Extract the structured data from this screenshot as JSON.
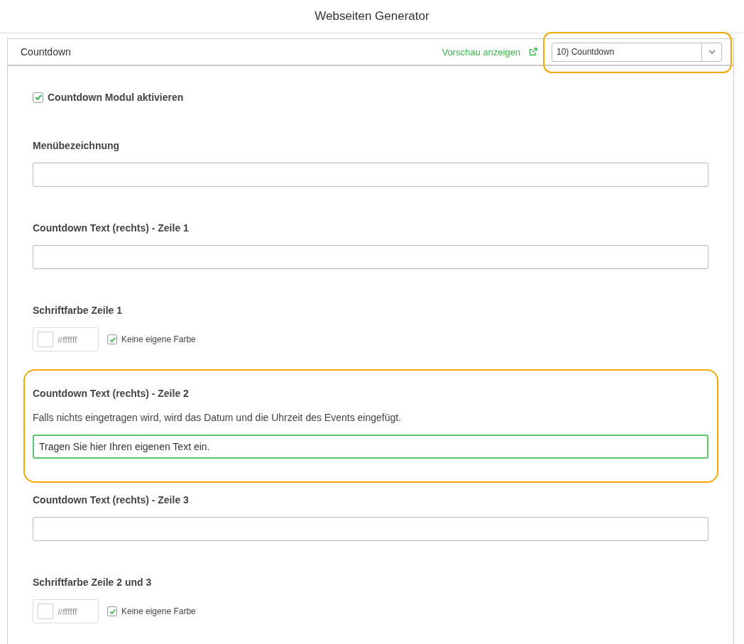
{
  "page_title": "Webseiten Generator",
  "panel": {
    "title": "Countdown",
    "preview_link": "Vorschau anzeigen",
    "module_select": {
      "value": "10) Countdown",
      "highlighted": true
    }
  },
  "fields": [
    {
      "kind": "checkbox",
      "label": "Countdown Modul aktivieren",
      "checked": true
    },
    {
      "kind": "text",
      "label": "Menübezeichnung",
      "focused": false,
      "highlighted": false
    },
    {
      "kind": "text",
      "label": "Countdown Text (rechts) - Zeile 1",
      "focused": false,
      "highlighted": false
    },
    {
      "kind": "color",
      "label": "Schriftfarbe Zeile 1",
      "color_value": "#ffffff",
      "option_label": "Keine eigene Farbe",
      "checked": true
    },
    {
      "kind": "text",
      "label": "Countdown Text (rechts) - Zeile 2",
      "hint": "Falls nichts eingetragen wird, wird das Datum und die Uhrzeit des Events eingefügt.",
      "value": "Tragen Sie hier Ihren eigenen Text ein.",
      "focused": true,
      "highlighted": true
    },
    {
      "kind": "text",
      "label": "Countdown Text (rechts) - Zeile 3",
      "focused": false,
      "highlighted": false
    },
    {
      "kind": "color",
      "label": "Schriftfarbe Zeile 2 und 3",
      "color_value": "#ffffff",
      "option_label": "Keine eigene Farbe",
      "checked": true
    }
  ]
}
